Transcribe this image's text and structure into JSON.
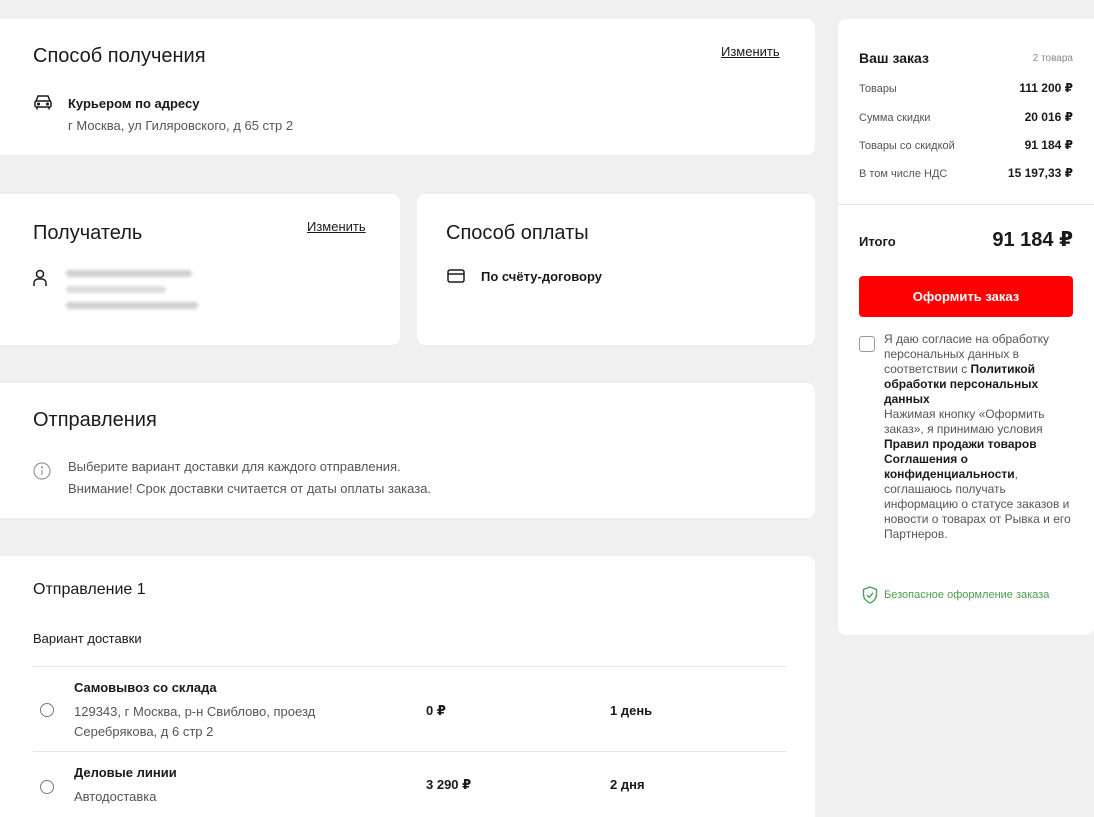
{
  "delivery": {
    "title": "Способ получения",
    "change_label": "Изменить",
    "method": "Курьером по адресу",
    "address": "г Москва, ул Гиляровского, д 65 стр 2",
    "icon": "car-icon"
  },
  "recipient": {
    "title": "Получатель",
    "change_label": "Изменить",
    "icon": "person-icon"
  },
  "payment": {
    "title": "Способ оплаты",
    "method": "По счёту-договору",
    "icon": "credit-card-icon"
  },
  "shipments": {
    "title": "Отправления",
    "info_line1": "Выберите вариант доставки для каждого отправления.",
    "info_line2": "Внимание! Срок доставки считается от даты оплаты заказа.",
    "icon": "info-icon"
  },
  "shipment1": {
    "title": "Отправление 1",
    "variant_label": "Вариант доставки",
    "options": [
      {
        "title": "Самовывоз со склада",
        "sub_line1": "129343, г Москва, р-н Свиблово, проезд",
        "sub_line2": "Серебрякова, д 6 стр 2",
        "price": "0 ₽",
        "days": "1 день"
      },
      {
        "title": "Деловые линии",
        "sub_line1": "Автодоставка",
        "price": "3 290 ₽",
        "days": "2 дня"
      }
    ]
  },
  "order": {
    "title": "Ваш заказ",
    "count": "2 товара",
    "rows": [
      {
        "label": "Товары",
        "value": "111 200 ₽"
      },
      {
        "label": "Сумма скидки",
        "value": "20 016 ₽"
      },
      {
        "label": "Товары со скидкой",
        "value": "91 184 ₽"
      },
      {
        "label": "В том числе НДС",
        "value": "15 197,33 ₽"
      }
    ],
    "total_label": "Итого",
    "total_value": "91 184 ₽",
    "submit_label": "Оформить заказ",
    "consent": {
      "p1": "Я даю согласие на обработку персональных данных в соответствии с ",
      "p1_bold": "Политикой обработки персональных данных",
      "p2": "Нажимая кнопку «Оформить заказ», я принимаю условия ",
      "p2_bold": "Правил продажи товаров Соглашения о конфиденциальности",
      "p3": ", соглашаюсь получать информацию о статусе заказов и новости о товарах от Рывка и его Партнеров."
    },
    "secure_text": "Безопасное оформление заказа"
  },
  "colors": {
    "accent": "#ff0000",
    "secure": "#4a9e4f",
    "background": "#f0f0f0"
  }
}
